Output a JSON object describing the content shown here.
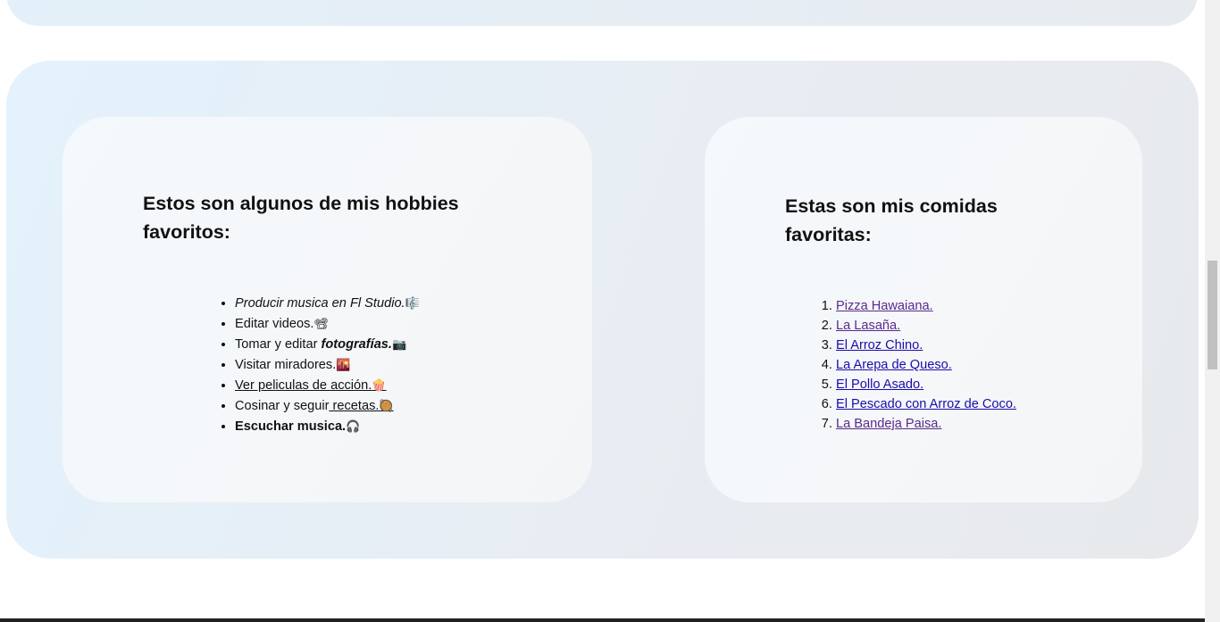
{
  "hobbies": {
    "title": "Estos son algunos de mis hobbies favoritos:",
    "items": [
      {
        "text": "Producir musica en Fl Studio.",
        "emoji": "🎼",
        "style": "italic"
      },
      {
        "text": "Editar videos.",
        "emoji": "📽",
        "style": "normal"
      },
      {
        "prefix": "Tomar y editar ",
        "text": "fotografías.",
        "emoji": "📷",
        "style": "bold-italic"
      },
      {
        "text": "Visitar miradores.",
        "emoji": "🌇",
        "style": "normal"
      },
      {
        "text": "Ver peliculas de acción.",
        "emoji": "🍿",
        "style": "underline"
      },
      {
        "prefix": "Cosinar y seguir",
        "text": " recetas.",
        "emoji": "🥘",
        "style": "underline-part"
      },
      {
        "text": "Escuchar musica.",
        "emoji": "🎧",
        "style": "bold"
      }
    ]
  },
  "foods": {
    "title": "Estas son mis comidas favoritas:",
    "items": [
      {
        "label": "Pizza Hawaiana.",
        "visited": true
      },
      {
        "label": "La Lasaña.",
        "visited": true
      },
      {
        "label": "El Arroz Chino.",
        "visited": false
      },
      {
        "label": "La Arepa de Queso.",
        "visited": false
      },
      {
        "label": "El Pollo Asado.",
        "visited": false
      },
      {
        "label": "El Pescado con Arroz de Coco.",
        "visited": false
      },
      {
        "label": "La Bandeja Paisa.",
        "visited": true
      }
    ]
  },
  "colors": {
    "link": "#1a0dab",
    "link_visited": "#5a2a8c",
    "section_bg": "#e5eef5",
    "card_bg": "#f4f7fa"
  }
}
